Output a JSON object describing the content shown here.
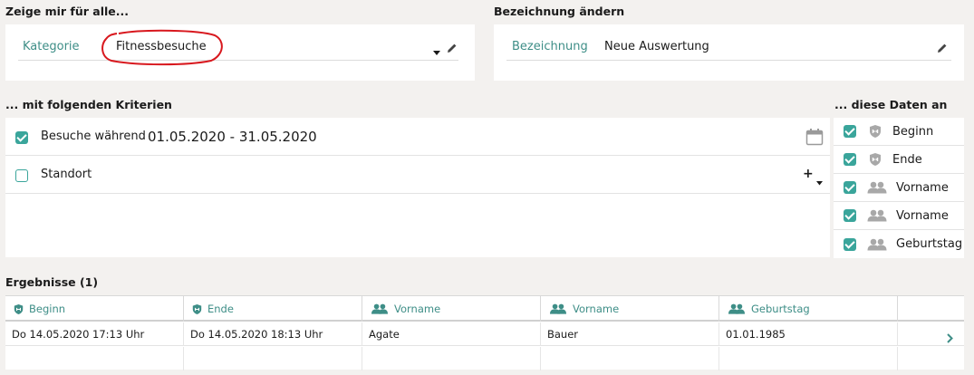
{
  "show_for": {
    "title": "Zeige mir für alle...",
    "label": "Kategorie",
    "value": "Fitnessbesuche",
    "dropdown_icon": "caret-down-icon",
    "edit_icon": "pencil-icon"
  },
  "rename": {
    "title": "Bezeichnung ändern",
    "label": "Bezeichnung",
    "value": "Neue Auswertung",
    "edit_icon": "pencil-icon"
  },
  "criteria": {
    "title": "... mit folgenden Kriterien",
    "items": [
      {
        "label": "Besuche während",
        "value": "01.05.2020 - 31.05.2020",
        "checked": true,
        "action_icon": "calendar-icon"
      },
      {
        "label": "Standort",
        "value": "",
        "checked": false,
        "action_icon": "plus-dropdown-icon"
      }
    ]
  },
  "show_data": {
    "title": "... diese Daten an",
    "items": [
      {
        "label": "Beginn",
        "checked": true,
        "icon": "shield-icon"
      },
      {
        "label": "Ende",
        "checked": true,
        "icon": "shield-icon"
      },
      {
        "label": "Vorname",
        "checked": true,
        "icon": "people-icon"
      },
      {
        "label": "Vorname",
        "checked": true,
        "icon": "people-icon"
      },
      {
        "label": "Geburtstag",
        "checked": true,
        "icon": "people-icon"
      }
    ]
  },
  "results": {
    "title": "Ergebnisse (1)",
    "columns": [
      {
        "label": "Beginn",
        "icon": "shield-icon"
      },
      {
        "label": "Ende",
        "icon": "shield-icon"
      },
      {
        "label": "Vorname",
        "icon": "people-icon"
      },
      {
        "label": "Vorname",
        "icon": "people-icon"
      },
      {
        "label": "Geburtstag",
        "icon": "people-icon"
      }
    ],
    "rows": [
      [
        "Do 14.05.2020 17:13 Uhr",
        "Do 14.05.2020 18:13 Uhr",
        "Agate",
        "Bauer",
        "01.01.1985"
      ]
    ],
    "row_action_icon": "chevron-right-icon"
  },
  "colors": {
    "accent": "#3aa59b",
    "label": "#3e8e87",
    "highlight_circle": "#d8181e"
  }
}
